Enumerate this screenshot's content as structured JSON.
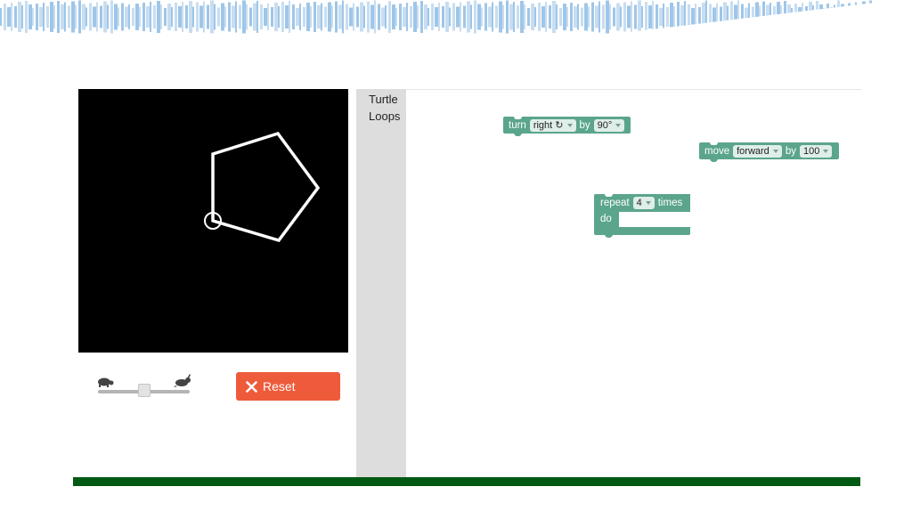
{
  "toolbox": {
    "categories": [
      "Turtle",
      "Loops"
    ]
  },
  "controls": {
    "reset_label": "Reset",
    "speed_slider_value": 0.5,
    "slow_icon": "turtle-icon",
    "fast_icon": "rabbit-icon",
    "reset_icon": "close-icon"
  },
  "blocks": {
    "turn": {
      "label": "turn",
      "direction": "right ↻",
      "by_label": "by",
      "angle": "90°"
    },
    "move": {
      "label": "move",
      "direction": "forward",
      "by_label": "by",
      "distance": "100"
    },
    "repeat": {
      "label": "repeat",
      "count": "4",
      "times_label": "times",
      "do_label": "do"
    }
  },
  "colors": {
    "block": "#5ba58c",
    "reset_button": "#ee5b3a",
    "stage_background": "#000000",
    "bottom_bar": "#005a13",
    "toolbox_background": "#dddddd",
    "banner": "#9fc6e8"
  }
}
